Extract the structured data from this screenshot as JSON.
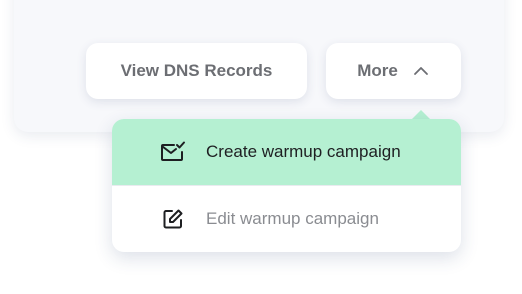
{
  "buttons": {
    "view_dns": "View DNS Records",
    "more": "More"
  },
  "icons": {
    "more_chevron": "chevron-up-icon",
    "create": "mail-check-icon",
    "edit": "pencil-square-icon"
  },
  "menu": {
    "items": [
      {
        "label": "Create warmup campaign",
        "highlighted": true
      },
      {
        "label": "Edit warmup campaign",
        "highlighted": false
      }
    ]
  },
  "colors": {
    "highlight": "#b5f0d2",
    "button_text": "#6c6e73",
    "menu_text_active": "#1e1f22",
    "menu_text_inactive": "#8a8c91"
  }
}
